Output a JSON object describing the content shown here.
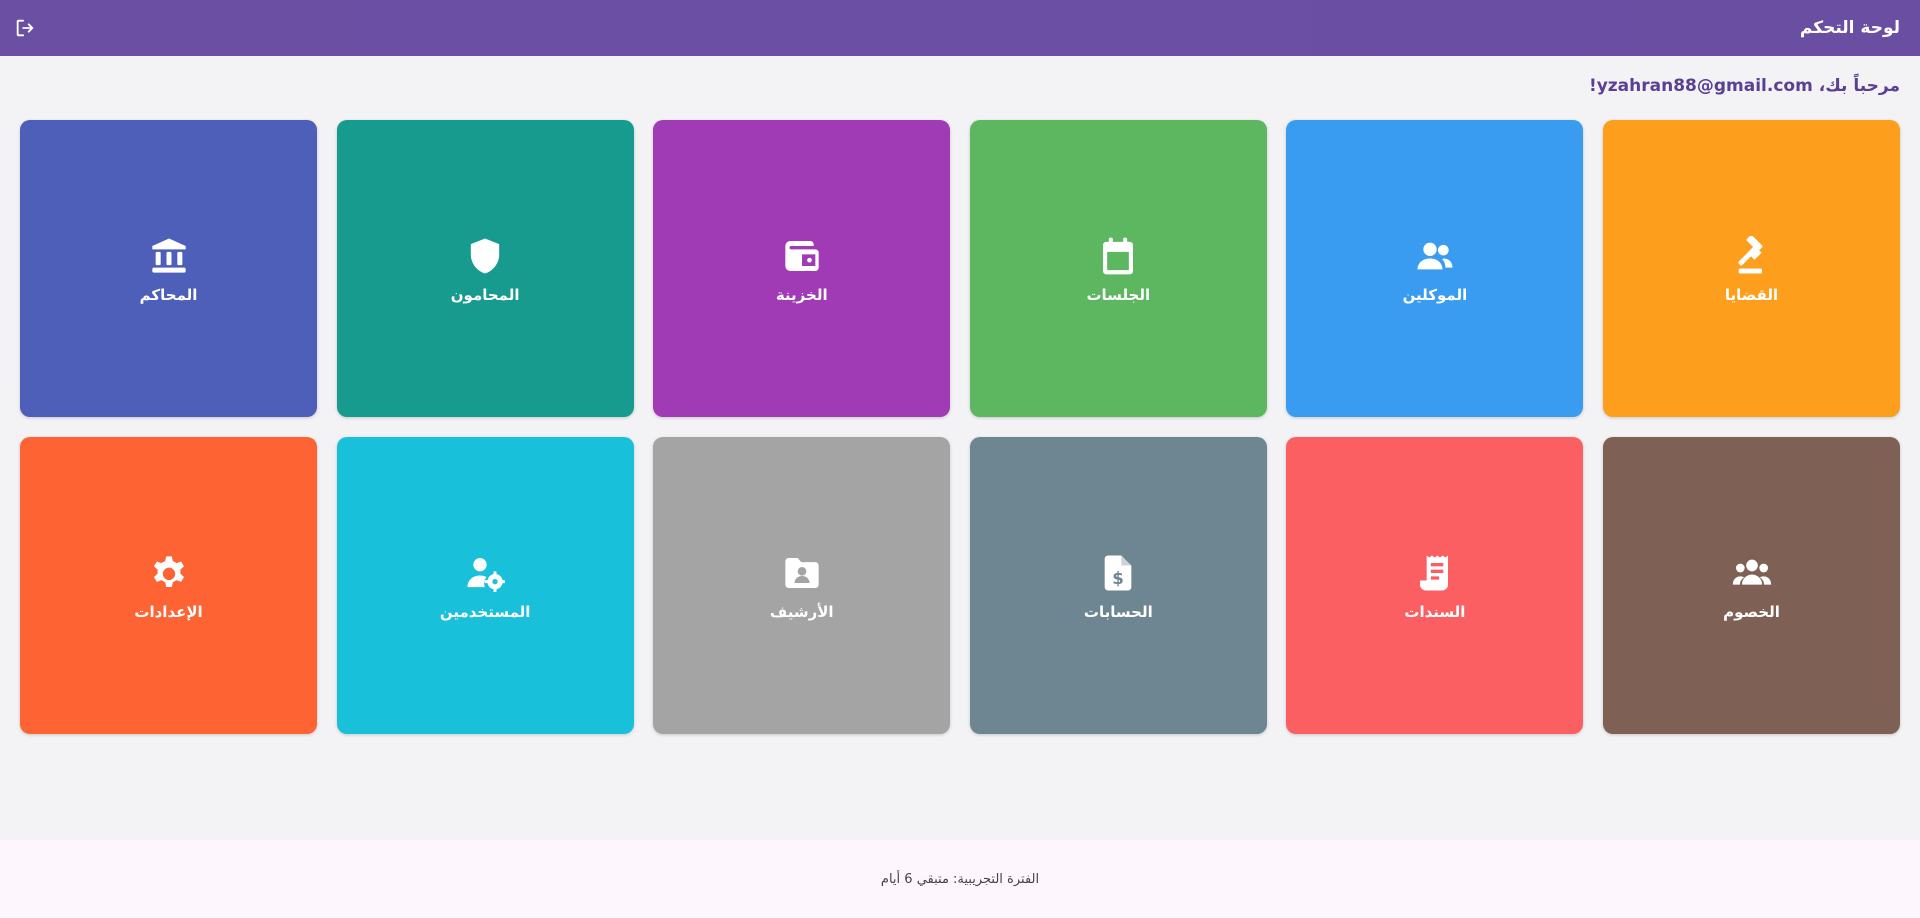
{
  "header": {
    "title": "لوحة التحكم",
    "logout_icon": "logout-icon",
    "background": "#6a4fa3"
  },
  "welcome": {
    "text": "مرحباً بك، yzahran88@gmail.com!"
  },
  "tiles": [
    {
      "label": "القضايا",
      "icon": "gavel-icon",
      "color": "#fd9e1c"
    },
    {
      "label": "الموكلين",
      "icon": "users-icon",
      "color": "#399cf1"
    },
    {
      "label": "الجلسات",
      "icon": "calendar-icon",
      "color": "#5db660"
    },
    {
      "label": "الخزينة",
      "icon": "wallet-icon",
      "color": "#a03ab5"
    },
    {
      "label": "المحامون",
      "icon": "shield-icon",
      "color": "#169b8e"
    },
    {
      "label": "المحاكم",
      "icon": "courthouse-icon",
      "color": "#4e5fb9"
    },
    {
      "label": "الخصوم",
      "icon": "group-icon",
      "color": "#7f6054"
    },
    {
      "label": "السندات",
      "icon": "receipt-icon",
      "color": "#fc5f61"
    },
    {
      "label": "الحسابات",
      "icon": "invoice-dollar-icon",
      "color": "#6e8592"
    },
    {
      "label": "الأرشيف",
      "icon": "folder-user-icon",
      "color": "#a4a4a4"
    },
    {
      "label": "المستخدمين",
      "icon": "user-gear-icon",
      "color": "#18c0da"
    },
    {
      "label": "الإعدادات",
      "icon": "gear-icon",
      "color": "#fe6334"
    }
  ],
  "footer": {
    "text": "الفترة التجريبية: متبقي 6 أيام"
  }
}
